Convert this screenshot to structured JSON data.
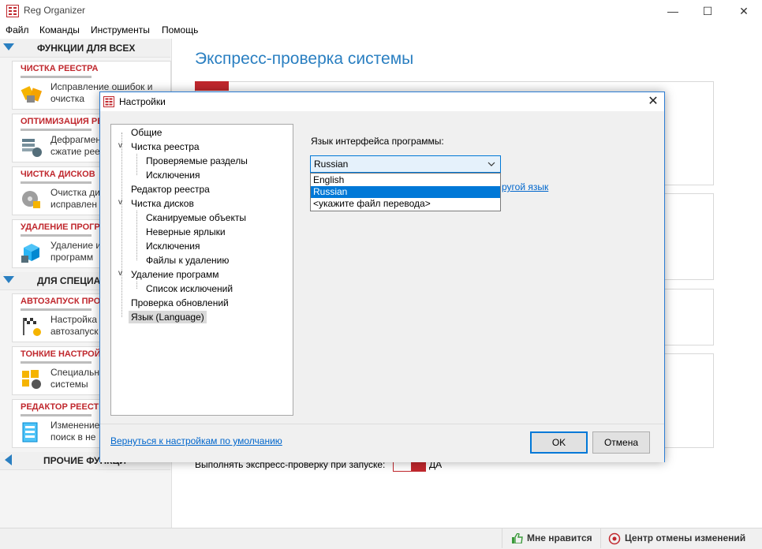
{
  "window": {
    "title": "Reg Organizer",
    "minimize": "—",
    "maximize": "☐",
    "close": "✕"
  },
  "menu": [
    "Файл",
    "Команды",
    "Инструменты",
    "Помощь"
  ],
  "sidebar": {
    "section1": "ФУНКЦИИ ДЛЯ ВСЕХ",
    "section2": "ДЛЯ СПЕЦИАЛ",
    "section3": "ПРОЧИЕ ФУНКЦИ",
    "panels": [
      {
        "title": "ЧИСТКА РЕЕСТРА",
        "line1": "Исправление ошибок и",
        "line2": "очистка",
        "icon": "broom-icon"
      },
      {
        "title": "ОПТИМИЗАЦИЯ РЕЕ",
        "line1": "Дефрагмен",
        "line2": "сжатие реес",
        "icon": "defrag-icon"
      },
      {
        "title": "ЧИСТКА ДИСКОВ",
        "line1": "Очистка ди",
        "line2": "исправлен",
        "icon": "disk-broom-icon"
      },
      {
        "title": "УДАЛЕНИЕ ПРОГРА",
        "line1": "Удаление и",
        "line2": "программ",
        "icon": "uninstall-box-icon"
      },
      {
        "title": "АВТОЗАПУСК ПРОГР",
        "line1": "Настройка",
        "line2": "автозапуск",
        "icon": "startup-flag-icon"
      },
      {
        "title": "ТОНКИЕ НАСТРОЙК",
        "line1": "Специальн",
        "line2": "системы",
        "icon": "windows-gear-icon"
      },
      {
        "title": "РЕДАКТОР РЕЕСТРА",
        "line1": "Изменение",
        "line2": "поиск в не",
        "icon": "registry-editor-icon"
      }
    ]
  },
  "main": {
    "title": "Экспресс-проверка системы",
    "autorun_label": "Выполнять экспресс-проверку при запуске:",
    "autorun_value": "ДА"
  },
  "statusbar": {
    "like": "Мне нравится",
    "undo_center": "Центр отмены изменений"
  },
  "dialog": {
    "title": "Настройки",
    "close": "✕",
    "tree": [
      {
        "label": "Общие",
        "level": 0,
        "toggle": ""
      },
      {
        "label": "Чистка реестра",
        "level": 0,
        "toggle": "v"
      },
      {
        "label": "Проверяемые разделы",
        "level": 1,
        "toggle": ""
      },
      {
        "label": "Исключения",
        "level": 1,
        "toggle": ""
      },
      {
        "label": "Редактор реестра",
        "level": 0,
        "toggle": ""
      },
      {
        "label": "Чистка дисков",
        "level": 0,
        "toggle": "v"
      },
      {
        "label": "Сканируемые объекты",
        "level": 1,
        "toggle": ""
      },
      {
        "label": "Неверные ярлыки",
        "level": 1,
        "toggle": ""
      },
      {
        "label": "Исключения",
        "level": 1,
        "toggle": ""
      },
      {
        "label": "Файлы к удалению",
        "level": 1,
        "toggle": ""
      },
      {
        "label": "Удаление программ",
        "level": 0,
        "toggle": "v"
      },
      {
        "label": "Список исключений",
        "level": 1,
        "toggle": ""
      },
      {
        "label": "Проверка обновлений",
        "level": 0,
        "toggle": ""
      },
      {
        "label": "Язык (Language)",
        "level": 0,
        "toggle": "",
        "selected": true
      }
    ],
    "language_label": "Язык интерфейса программы:",
    "language_selected": "Russian",
    "language_options": [
      "English",
      "Russian",
      "<укажите файл перевода>"
    ],
    "other_language_link": "ругой язык",
    "reset_link": "Вернуться к настройкам по умолчанию",
    "ok": "OK",
    "cancel": "Отмена"
  },
  "colors": {
    "accent_red": "#c0272d",
    "accent_blue": "#2a7fc1",
    "selection": "#0078d7"
  }
}
